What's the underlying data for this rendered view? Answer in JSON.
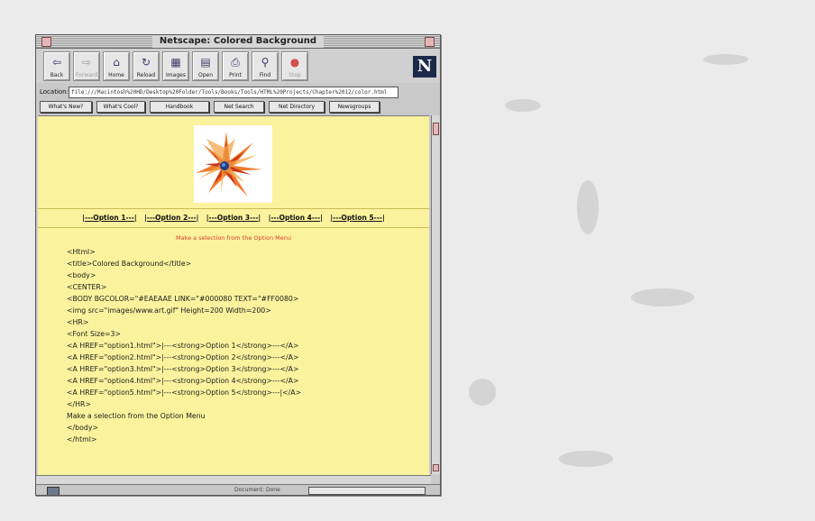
{
  "window": {
    "title": "Netscape: Colored Background"
  },
  "toolbar": {
    "buttons": [
      {
        "label": "Back",
        "icon": "back-arrow-icon",
        "glyph": "⇦",
        "enabled": true
      },
      {
        "label": "Forward",
        "icon": "forward-arrow-icon",
        "glyph": "⇨",
        "enabled": false
      },
      {
        "label": "Home",
        "icon": "home-icon",
        "glyph": "⌂",
        "enabled": true
      },
      {
        "label": "Reload",
        "icon": "reload-icon",
        "glyph": "↻",
        "enabled": true
      },
      {
        "label": "Images",
        "icon": "images-icon",
        "glyph": "▦",
        "enabled": true
      },
      {
        "label": "Open",
        "icon": "open-icon",
        "glyph": "▤",
        "enabled": true
      },
      {
        "label": "Print",
        "icon": "printer-icon",
        "glyph": "⎙",
        "enabled": true
      },
      {
        "label": "Find",
        "icon": "find-binoculars-icon",
        "glyph": "⚲",
        "enabled": true
      },
      {
        "label": "Stop",
        "icon": "stop-icon",
        "glyph": "●",
        "enabled": false
      }
    ],
    "logo": "N"
  },
  "location": {
    "label": "Location:",
    "value": "file:///Macintosh%20HD/Desktop%20Folder/Tools/Books/Tools/HTML%20Projects/Chapter%2012/color.html"
  },
  "directory_buttons": [
    "What's New?",
    "What's Cool?",
    "Handbook",
    "Net Search",
    "Net Directory",
    "Newsgroups"
  ],
  "page": {
    "options": [
      "|---Option 1---|",
      "|---Option 2---|",
      "|---Option 3---|",
      "|---Option 4---|",
      "|---Option 5---|"
    ],
    "instruction": "Make a selection from the Option Menu",
    "code_lines": [
      "<Html>",
      "<title>Colored Background</title>",
      "<body>",
      "<CENTER>",
      "<BODY BGCOLOR=\"#EAEAAE LINK=\"#000080 TEXT=\"#FF0080>",
      "<img src=\"images/www.art.gif\" Height=200 Width=200>",
      "<HR>",
      "<Font Size=3>",
      "<A HREF=\"option1.html\">|---<strong>Option 1</strong>---</A>",
      "<A HREF=\"option2.html\">|---<strong>Option 2</strong>---</A>",
      "<A HREF=\"option3.html\">|---<strong>Option 3</strong>---</A>",
      "<A HREF=\"option4.html\">|---<strong>Option 4</strong>---</A>",
      "<A HREF=\"option5.html\">|---<strong>Option 5</strong>---|</A>",
      "</HR>",
      "Make a selection from the Option Menu",
      "</body>",
      "</html>"
    ]
  },
  "status": {
    "text": "Document: Done"
  },
  "colors": {
    "page_background": "#fbf29d",
    "link": "#000080",
    "instruction_text": "#d8402a"
  }
}
